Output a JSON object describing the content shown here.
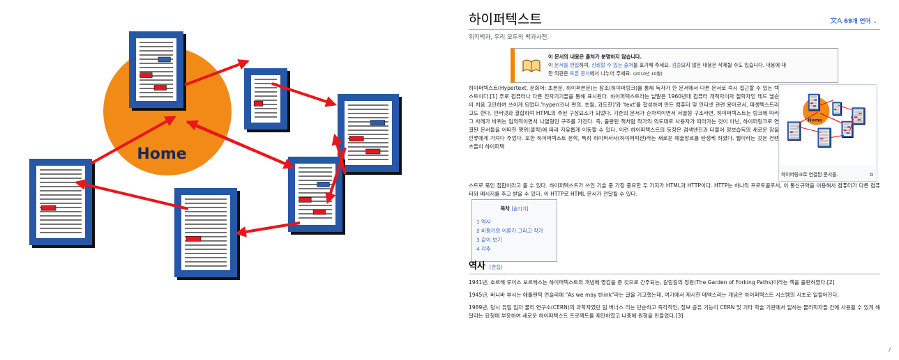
{
  "illustration": {
    "home_label": "Home",
    "colors": {
      "home_circle": "#f28a18",
      "page_frame": "#2757a7",
      "arrow": "#e8171b",
      "line": "#222222",
      "highlight": "#2e5eb0"
    }
  },
  "wiki": {
    "title": "하이퍼텍스트",
    "lang_icon": "translate-icon",
    "lang_button": "69개 언어",
    "tagline": "위키백과, 우리 모두의 백과사전.",
    "notice": {
      "title": "이 문서의 내용은 출처가 분명하지 않습니다.",
      "line1_a": "이 ",
      "line1_link1": "문서를 편집",
      "line1_b": "하여, ",
      "line1_link2": "신뢰할 수 있는 출처",
      "line1_c": "를 표기해 주세요. ",
      "line1_link3": "검증",
      "line1_d": "되지 않은 내용은 삭제될 수도 있습니다. 내용에 대",
      "line2_a": "한 의견은 ",
      "line2_link": "토론 문서",
      "line2_b": "에서 나누어 주세요.",
      "date": "(2010년 10월)"
    },
    "lead": {
      "p1": "하이퍼텍스트(Hypertext, 문화어: 초본문, 하이퍼본문)는 참조(하이퍼링크)를 통해 독자가 한 문서에서 다른 문서로 즉시 접근할 수 있는 텍스트이다.[1] 주로 컴퓨터나 다른 전자기기들을 통해 표시된다. 하이퍼텍스트라는 낱말은 1960년대 컴퓨터 개척자이자 철학자인 테드 넬슨이 처음 고안하여 쓰이게 되었다.'hyper(건너 편의, 초월, 과도한)'와 'text'를 합성하여 만든 컴퓨터 및 인터넷 관련 용어로서, 파생텍스트라고도 한다. 인터넷과 결합하여 HTML의 주된 구성요소가 되었다. 기존의 문서가 순차적이면서 서열형 구조라면, 하이퍼텍스트는 링크에 따라 그 차례가 바뀌는 임의적이면서 나열형인 구조를 가진다. 즉, 출판된 책처럼 작가의 의도대로 사용자가 따라가는 것이 아닌, 하이퍼링크로 연결된 문서들을 어떠한 행위(클릭)에 따라 자유롭게 이동할 수 있다. 이런 하이퍼텍스트의 등장은 검색엔진과 더불어 정보습득의 새로운 장을 인류에게 가져다 주었다. 또한 하이퍼텍스트 문학, 특히 하이퍼서사(하이퍼픽션)라는 새로운 예술장르를 탄생케 하였다. 웹이라는 것은 컨텐츠들이 하이퍼텍",
      "p1_end": "스트로 묶인 집합이라고 볼 수 있다. 하이퍼텍스트가 쓰인 기술 중 가장 중요한 두 가지가 HTML과 HTTP이다. HTTP는 하나의 프로토콜로서, 이 통신규약을 이용해서 컴퓨터가 다른 컴퓨터와 메시지를 주고 받을 수 있다. 이 HTTP로 HTML 문서가 전달될 수 있다."
    },
    "infobox": {
      "home_label": "Home",
      "caption": "하이퍼링크로 연결된 문서들.",
      "expand_icon": "enlarge-icon"
    },
    "toc": {
      "title": "목차",
      "toggle": "[숨기기]",
      "items": [
        "1 역사",
        "2 비평가와 이론가 그리고 작가",
        "3 같이 보기",
        "4 각주"
      ]
    },
    "history": {
      "title": "역사",
      "edit_open": "[",
      "edit": "편집",
      "edit_close": "]",
      "p1": "1941년, 호르헤 루이스 보르헤스는 하이퍼텍스트의 개념에 영감을 준 것으로 간주되는, 갈림길의 정원(The Garden of Forking Paths)이라는 책을 출판하였다.[2]",
      "p2": "1945년, 버니바 부시는 애틀랜틱 먼슬리에 \"As we may think\"라는 글을 기고했는데, 여기에서 제시한 메멕스라는 개념은 하이퍼텍스트 시스템의 시초로 일컬어진다.",
      "p3": "1989년, 당시 유럽 입자 물리 연구소(CERN)의 과학자였던 팀 버너스 리는 단순하고 즉각적인, 정보 공유 기능이 CERN 및 기타 학술 기관에서 일하는 물리학자들 간에 사용될 수 있게 해달라는 요청에 부응하여 새로운 하이퍼텍스트 프로젝트를 제안하였고 나중에 원형을 만들었다.[3]"
    },
    "corner_mark": "/"
  }
}
